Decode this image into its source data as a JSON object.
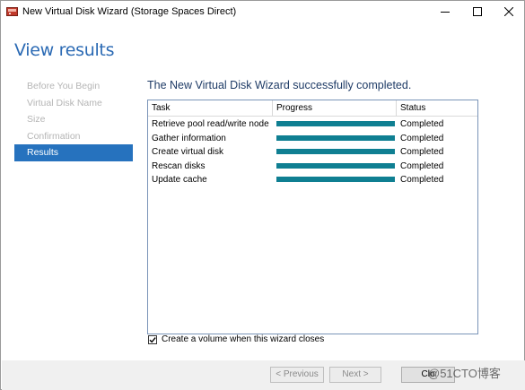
{
  "window": {
    "title": "New Virtual Disk Wizard (Storage Spaces Direct)",
    "icon": "virtual-disk-wizard-icon"
  },
  "page": {
    "title": "View results"
  },
  "nav": {
    "items": [
      {
        "label": "Before You Begin",
        "active": false
      },
      {
        "label": "Virtual Disk Name",
        "active": false
      },
      {
        "label": "Size",
        "active": false
      },
      {
        "label": "Confirmation",
        "active": false
      },
      {
        "label": "Results",
        "active": true
      }
    ]
  },
  "results": {
    "message": "The New Virtual Disk Wizard successfully completed.",
    "columns": [
      "Task",
      "Progress",
      "Status"
    ],
    "rows": [
      {
        "task": "Retrieve pool read/write node",
        "progress": 100,
        "status": "Completed"
      },
      {
        "task": "Gather information",
        "progress": 100,
        "status": "Completed"
      },
      {
        "task": "Create virtual disk",
        "progress": 100,
        "status": "Completed"
      },
      {
        "task": "Rescan disks",
        "progress": 100,
        "status": "Completed"
      },
      {
        "task": "Update cache",
        "progress": 100,
        "status": "Completed"
      }
    ]
  },
  "options": {
    "create_volume_label": "Create a volume when this wizard closes",
    "create_volume_checked": true
  },
  "footer": {
    "previous_label": "< Previous",
    "next_label": "Next >",
    "close_label": "Clo"
  },
  "watermark": "@51CTO博客",
  "colors": {
    "accent": "#2672be",
    "progress": "#0f7f92",
    "title": "#2b6ab4"
  }
}
